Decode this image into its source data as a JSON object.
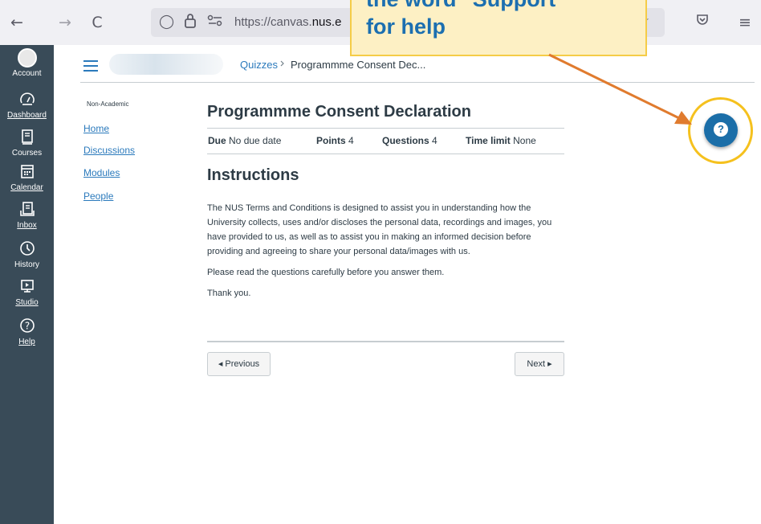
{
  "browser": {
    "back_icon": "←",
    "forward_icon": "→",
    "reload_icon": "C",
    "shield_icon": "◯",
    "lock_icon": "🔒",
    "permissions_icon": "⚲",
    "url_prefix": "https://canvas.",
    "url_domain": "nus.e",
    "bookmark_icon": "☆",
    "pocket_icon": "◇",
    "menu_icon": "≡"
  },
  "callout": {
    "line1": "the word \"Support\"",
    "line2": "for help"
  },
  "global_nav": {
    "items": [
      {
        "label": "Account",
        "icon": "avatar"
      },
      {
        "label": "Dashboard",
        "icon": "dashboard-gauge-icon",
        "glyph": "◔"
      },
      {
        "label": "Courses",
        "icon": "courses-book-icon",
        "glyph": "▤"
      },
      {
        "label": "Calendar",
        "icon": "calendar-icon",
        "glyph": "▦"
      },
      {
        "label": "Inbox",
        "icon": "inbox-icon",
        "glyph": "▥"
      },
      {
        "label": "History",
        "icon": "history-clock-icon",
        "glyph": "◷"
      },
      {
        "label": "Studio",
        "icon": "studio-icon",
        "glyph": "▣"
      },
      {
        "label": "Help",
        "icon": "help-circle-icon",
        "glyph": "?"
      }
    ]
  },
  "breadcrumb": {
    "parent": "Quizzes",
    "separator": ">",
    "current": "Programmme Consent Dec..."
  },
  "course_nav": {
    "label": "Non-Academic",
    "links": [
      "Home",
      "Discussions",
      "Modules",
      "People"
    ]
  },
  "quiz": {
    "title": "Programmme Consent Declaration",
    "due_label": "Due",
    "due_value": "No due date",
    "points_label": "Points",
    "points_value": "4",
    "questions_label": "Questions",
    "questions_value": "4",
    "time_label": "Time limit",
    "time_value": "None",
    "instructions_title": "Instructions",
    "paragraph1": "The NUS Terms and Conditions is designed to assist you in understanding how the University collects, uses and/or discloses the personal data, recordings and images, you have provided to us, as well as to assist you in making an informed decision before providing and agreeing to share your personal data/images with us.",
    "paragraph2": "Please read the questions carefully before you answer them.",
    "paragraph3": "Thank you.",
    "previous_label": "◂ Previous",
    "next_label": "Next ▸"
  },
  "help_button": {
    "glyph": "?"
  },
  "colors": {
    "nav_bg": "#394b58",
    "link": "#2b7abc",
    "help_button": "#1b6ea8",
    "highlight": "#f5c11e",
    "arrow": "#e07b2e",
    "callout_bg": "#fdf0c4"
  }
}
